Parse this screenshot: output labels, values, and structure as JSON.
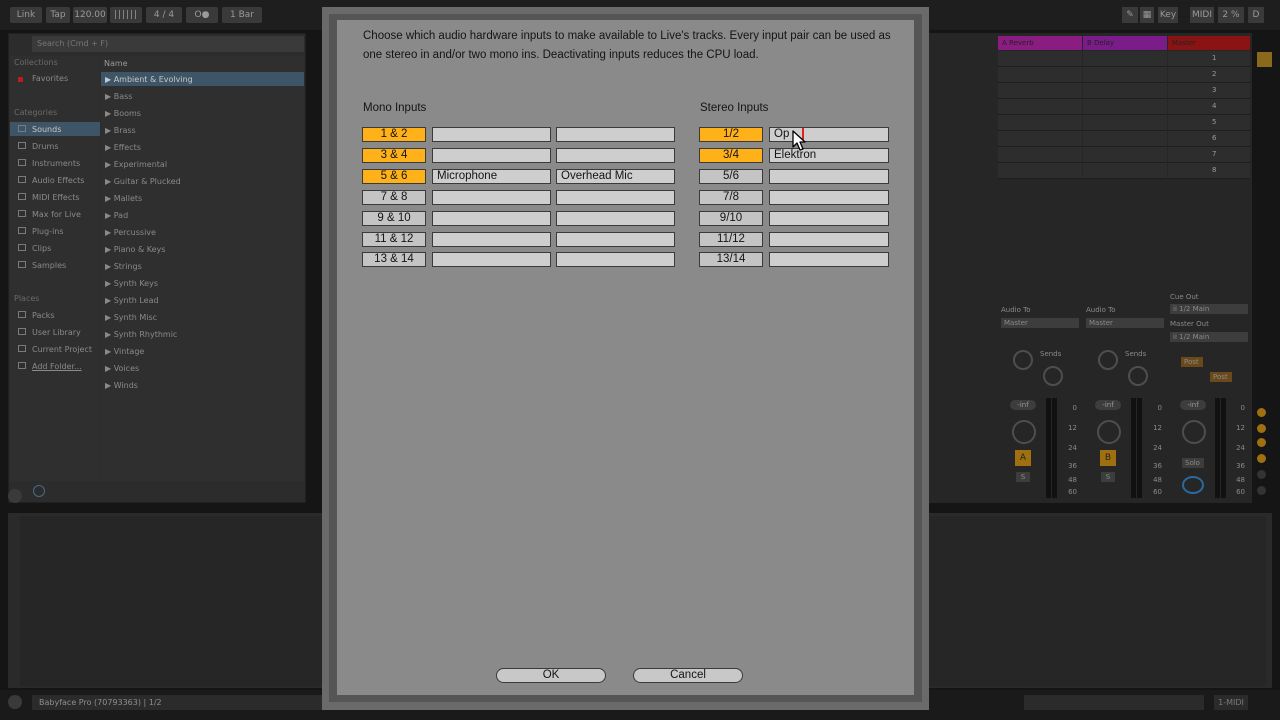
{
  "topbar": {
    "link": "Link",
    "tap": "Tap",
    "tempo": "120.00",
    "sig_num": "4",
    "sig_sep": "/",
    "sig_den": "4",
    "metro": "O●",
    "quant": "1 Bar",
    "key": "Key",
    "midi": "MIDI",
    "cpu": "2 %",
    "d": "D"
  },
  "browser": {
    "search_placeholder": "Search (Cmd + F)",
    "collections_header": "Collections",
    "favorites": "Favorites",
    "categories_header": "Categories",
    "categories": [
      "Sounds",
      "Drums",
      "Instruments",
      "Audio Effects",
      "MIDI Effects",
      "Max for Live",
      "Plug-ins",
      "Clips",
      "Samples"
    ],
    "places_header": "Places",
    "places": [
      "Packs",
      "User Library",
      "Current Project",
      "Add Folder..."
    ],
    "name_header": "Name",
    "items": [
      "Ambient & Evolving",
      "Bass",
      "Booms",
      "Brass",
      "Effects",
      "Experimental",
      "Guitar & Plucked",
      "Mallets",
      "Pad",
      "Percussive",
      "Piano & Keys",
      "Strings",
      "Synth Keys",
      "Synth Lead",
      "Synth Misc",
      "Synth Rhythmic",
      "Vintage",
      "Voices",
      "Winds"
    ]
  },
  "mixer": {
    "returns": [
      "A Reverb",
      "B Delay"
    ],
    "master": "Master",
    "scenes": [
      "1",
      "2",
      "3",
      "4",
      "5",
      "6",
      "7",
      "8"
    ],
    "audio_to": "Audio To",
    "master_opt": "Master",
    "sends": "Sends",
    "cue_out": "Cue Out",
    "cue_out_val": "ii 1/2 Main",
    "master_out": "Master Out",
    "master_out_val": "ii 1/2 Main",
    "post": "Post",
    "inf": "-inf",
    "scale": [
      "0",
      "12",
      "24",
      "36",
      "48",
      "60"
    ],
    "a_btn": "A",
    "b_btn": "B",
    "s_btn": "S",
    "solo": "Solo"
  },
  "status": {
    "device": "Babyface Pro (70793363) | 1/2",
    "midi_track": "1-MIDI"
  },
  "dialog": {
    "description": "Choose which audio hardware inputs to make available to Live's tracks. Every input pair can be used as one stereo in and/or two mono ins.  Deactivating inputs reduces the CPU load.",
    "mono_header": "Mono Inputs",
    "stereo_header": "Stereo Inputs",
    "mono": [
      {
        "pair": "1 & 2",
        "active": true,
        "left": "",
        "right": ""
      },
      {
        "pair": "3 & 4",
        "active": true,
        "left": "",
        "right": ""
      },
      {
        "pair": "5 & 6",
        "active": true,
        "left": "Microphone",
        "right": "Overhead Mic"
      },
      {
        "pair": "7 & 8",
        "active": false,
        "left": "",
        "right": ""
      },
      {
        "pair": "9 & 10",
        "active": false,
        "left": "",
        "right": ""
      },
      {
        "pair": "11 & 12",
        "active": false,
        "left": "",
        "right": ""
      },
      {
        "pair": "13 & 14",
        "active": false,
        "left": "",
        "right": ""
      }
    ],
    "stereo": [
      {
        "pair": "1/2",
        "active": true,
        "name": "Op"
      },
      {
        "pair": "3/4",
        "active": true,
        "name": "Elektron"
      },
      {
        "pair": "5/6",
        "active": false,
        "name": ""
      },
      {
        "pair": "7/8",
        "active": false,
        "name": ""
      },
      {
        "pair": "9/10",
        "active": false,
        "name": ""
      },
      {
        "pair": "11/12",
        "active": false,
        "name": ""
      },
      {
        "pair": "13/14",
        "active": false,
        "name": ""
      }
    ],
    "ok": "OK",
    "cancel": "Cancel"
  },
  "colors": {
    "active_pair": "#ffb119",
    "inactive_pair": "#c4c4c4",
    "caret": "#e0201c",
    "reverb": "#8a1c82",
    "delay": "#7a1c8a",
    "master": "#8a1414"
  }
}
